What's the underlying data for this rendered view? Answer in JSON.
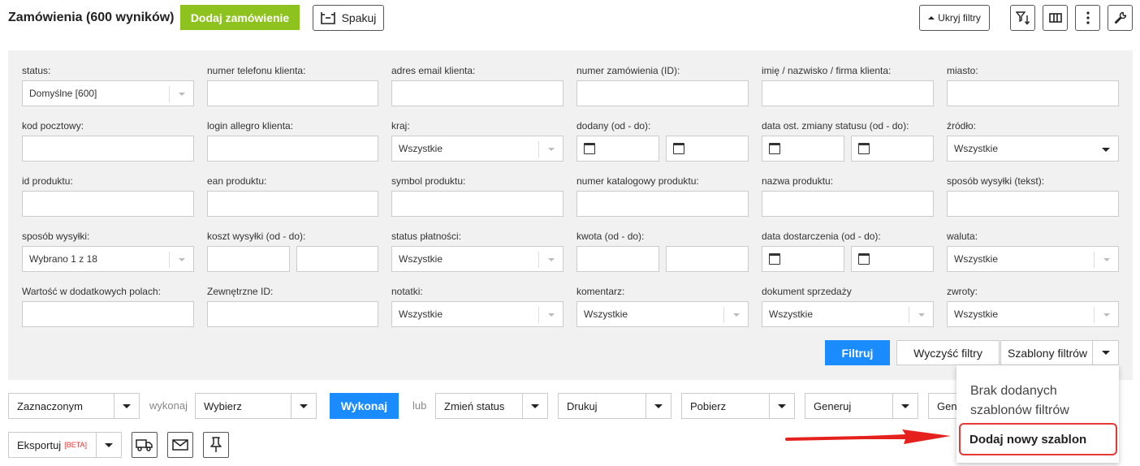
{
  "header": {
    "title": "Zamówienia (600 wyników)",
    "add_order": "Dodaj zamówienie",
    "pack": "Spakuj",
    "hide_filters": "Ukryj filtry"
  },
  "filters": {
    "status": {
      "label": "status:",
      "value": "Domyślne [600]"
    },
    "phone": {
      "label": "numer telefonu klienta:"
    },
    "email": {
      "label": "adres email klienta:"
    },
    "order_id": {
      "label": "numer zamówienia (ID):"
    },
    "name": {
      "label": "imię / nazwisko / firma klienta:"
    },
    "city": {
      "label": "miasto:"
    },
    "postcode": {
      "label": "kod pocztowy:"
    },
    "allegro_login": {
      "label": "login allegro klienta:"
    },
    "country": {
      "label": "kraj:",
      "value": "Wszystkie"
    },
    "added": {
      "label": "dodany (od - do):"
    },
    "status_change": {
      "label": "data ost. zmiany statusu (od - do):"
    },
    "source": {
      "label": "źródło:",
      "value": "Wszystkie"
    },
    "product_id": {
      "label": "id produktu:"
    },
    "ean": {
      "label": "ean produktu:"
    },
    "symbol": {
      "label": "symbol produktu:"
    },
    "catalog_no": {
      "label": "numer katalogowy produktu:"
    },
    "product_name": {
      "label": "nazwa produktu:"
    },
    "shipping_text": {
      "label": "sposób wysyłki (tekst):"
    },
    "shipping": {
      "label": "sposób wysyłki:",
      "value": "Wybrano 1 z 18"
    },
    "shipping_cost": {
      "label": "koszt wysyłki (od - do):"
    },
    "payment_status": {
      "label": "status płatności:",
      "value": "Wszystkie"
    },
    "amount": {
      "label": "kwota (od - do):"
    },
    "delivery_date": {
      "label": "data dostarczenia (od - do):"
    },
    "currency": {
      "label": "waluta:",
      "value": "Wszystkie"
    },
    "extra_fields": {
      "label": "Wartość w dodatkowych polach:"
    },
    "external_id": {
      "label": "Zewnętrzne ID:"
    },
    "notes": {
      "label": "notatki:",
      "value": "Wszystkie"
    },
    "comment": {
      "label": "komentarz:",
      "value": "Wszystkie"
    },
    "sales_doc": {
      "label": "dokument sprzedaży",
      "value": "Wszystkie"
    },
    "returns": {
      "label": "zwroty:",
      "value": "Wszystkie"
    }
  },
  "filter_actions": {
    "filter": "Filtruj",
    "clear": "Wyczyść filtry",
    "templates": "Szablony filtrów"
  },
  "templates_menu": {
    "empty": "Brak dodanych szablonów filtrów",
    "add_new": "Dodaj nowy szablon"
  },
  "bulk": {
    "selected": "Zaznaczonym",
    "execute_label": "wykonaj",
    "choose": "Wybierz",
    "execute_btn": "Wykonaj",
    "or": "lub",
    "change_status": "Zmień status",
    "print": "Drukuj",
    "download": "Pobierz",
    "generate": "Generuj",
    "generate2": "Gene",
    "export": "Eksportuj",
    "beta": "[BETA]"
  },
  "colors": {
    "green": "#8dc21f",
    "blue": "#1a8cff",
    "highlight": "#e53935"
  }
}
